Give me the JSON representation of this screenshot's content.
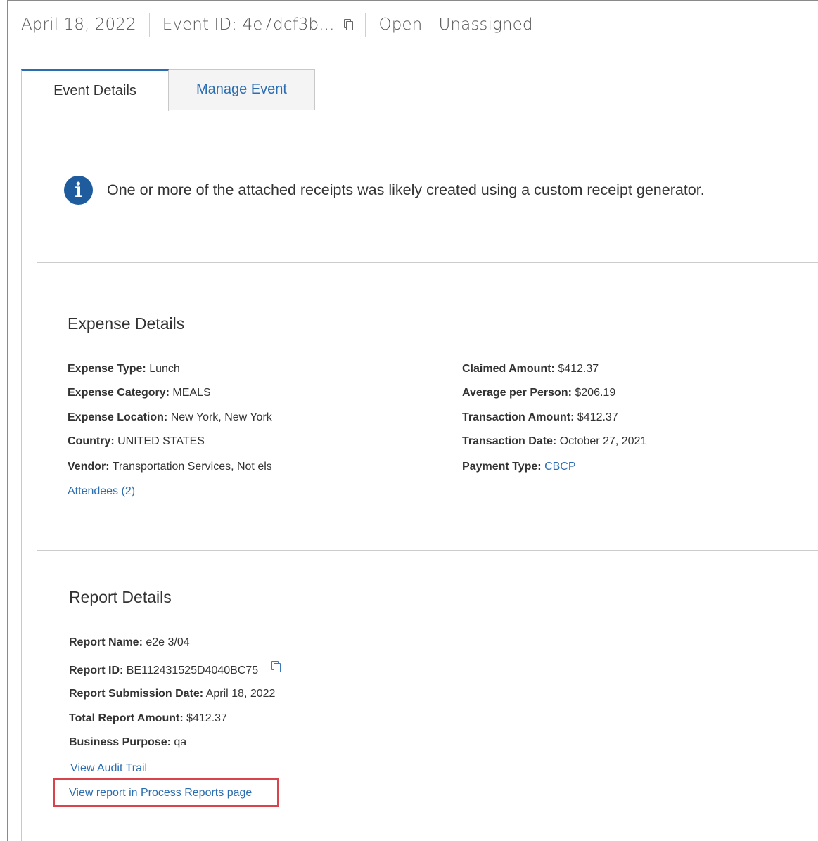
{
  "header": {
    "date": "April 18, 2022",
    "event_id_label": "Event ID: 4e7dcf3b...",
    "status": "Open - Unassigned"
  },
  "tabs": [
    {
      "label": "Event Details",
      "active": true
    },
    {
      "label": "Manage Event",
      "active": false
    }
  ],
  "info_banner": {
    "icon": "info-icon",
    "text": "One or more of the attached receipts was likely created using a custom receipt generator."
  },
  "expense_details": {
    "title": "Expense Details",
    "left": [
      {
        "label": "Expense Type:",
        "value": "Lunch"
      },
      {
        "label": "Expense Category:",
        "value": "MEALS"
      },
      {
        "label": "Expense Location:",
        "value": "New York, New York"
      },
      {
        "label": "Country:",
        "value": "UNITED STATES"
      },
      {
        "label": "Vendor:",
        "value": "Transportation Services, Not els"
      }
    ],
    "attendees_link": "Attendees (2)",
    "right": [
      {
        "label": "Claimed Amount:",
        "value": "$412.37"
      },
      {
        "label": "Average per Person:",
        "value": "$206.19"
      },
      {
        "label": "Transaction Amount:",
        "value": "$412.37"
      },
      {
        "label": "Transaction Date:",
        "value": "October 27, 2021"
      },
      {
        "label": "Payment Type:",
        "value": "CBCP"
      }
    ]
  },
  "report_details": {
    "title": "Report Details",
    "rows": [
      {
        "label": "Report Name:",
        "value": "e2e 3/04"
      },
      {
        "label": "Report ID:",
        "value": "BE112431525D4040BC75"
      },
      {
        "label": "Report Submission Date:",
        "value": "April 18, 2022"
      },
      {
        "label": "Total Report Amount:",
        "value": "$412.37"
      },
      {
        "label": "Business Purpose:",
        "value": "qa"
      }
    ],
    "view_audit_trail": "View Audit Trail",
    "view_process_reports": "View report in Process Reports page"
  },
  "colors": {
    "accent": "#2a6db0",
    "info_icon": "#1f5c9e",
    "highlight": "#d9434b"
  }
}
